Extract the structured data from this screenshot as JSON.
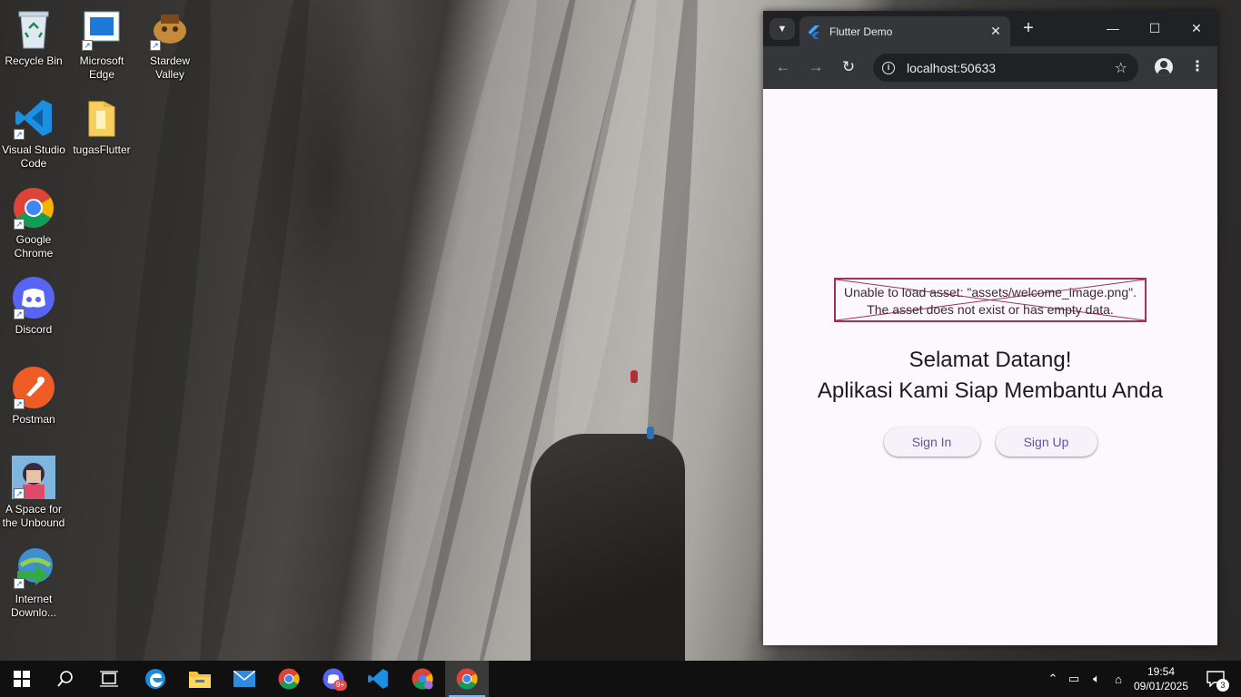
{
  "desktop": {
    "icons": [
      {
        "label": "Recycle Bin",
        "icon": "recycle-bin-icon"
      },
      {
        "label": "Microsoft Edge",
        "icon": "edge-icon"
      },
      {
        "label": "Stardew Valley",
        "icon": "stardew-valley-icon"
      },
      {
        "label": "Visual Studio Code",
        "icon": "vscode-icon"
      },
      {
        "label": "tugasFlutter",
        "icon": "folder-icon"
      },
      {
        "label": "Google Chrome",
        "icon": "chrome-icon"
      },
      {
        "label": "Discord",
        "icon": "discord-icon"
      },
      {
        "label": "Postman",
        "icon": "postman-icon"
      },
      {
        "label": "A Space for the Unbound",
        "icon": "game-icon"
      },
      {
        "label": "Internet Downlo...",
        "icon": "internet-download-manager-icon"
      }
    ]
  },
  "browser": {
    "tab_title": "Flutter Demo",
    "url": "localhost:50633",
    "page": {
      "error_line1": "Unable to load asset: \"assets/welcome_image.png\".",
      "error_line2": "The asset does not exist or has empty data.",
      "welcome_line1": "Selamat Datang!",
      "welcome_line2": "Aplikasi Kami Siap Membantu Anda",
      "sign_in": "Sign In",
      "sign_up": "Sign Up"
    }
  },
  "taskbar": {
    "apps": [
      "start-icon",
      "search-icon",
      "task-view-icon",
      "edge-icon",
      "file-explorer-icon",
      "mail-icon",
      "chrome-icon",
      "discord-icon",
      "vscode-icon",
      "chrome-profile-icon",
      "chrome-icon"
    ],
    "discord_badge": "9+",
    "time": "19:54",
    "date": "09/01/2025",
    "notification_count": "3"
  },
  "colors": {
    "flutter_primary": "#6750a4",
    "page_background": "#fdf7fe",
    "error_border": "#a33255",
    "taskbar": "#101010"
  }
}
